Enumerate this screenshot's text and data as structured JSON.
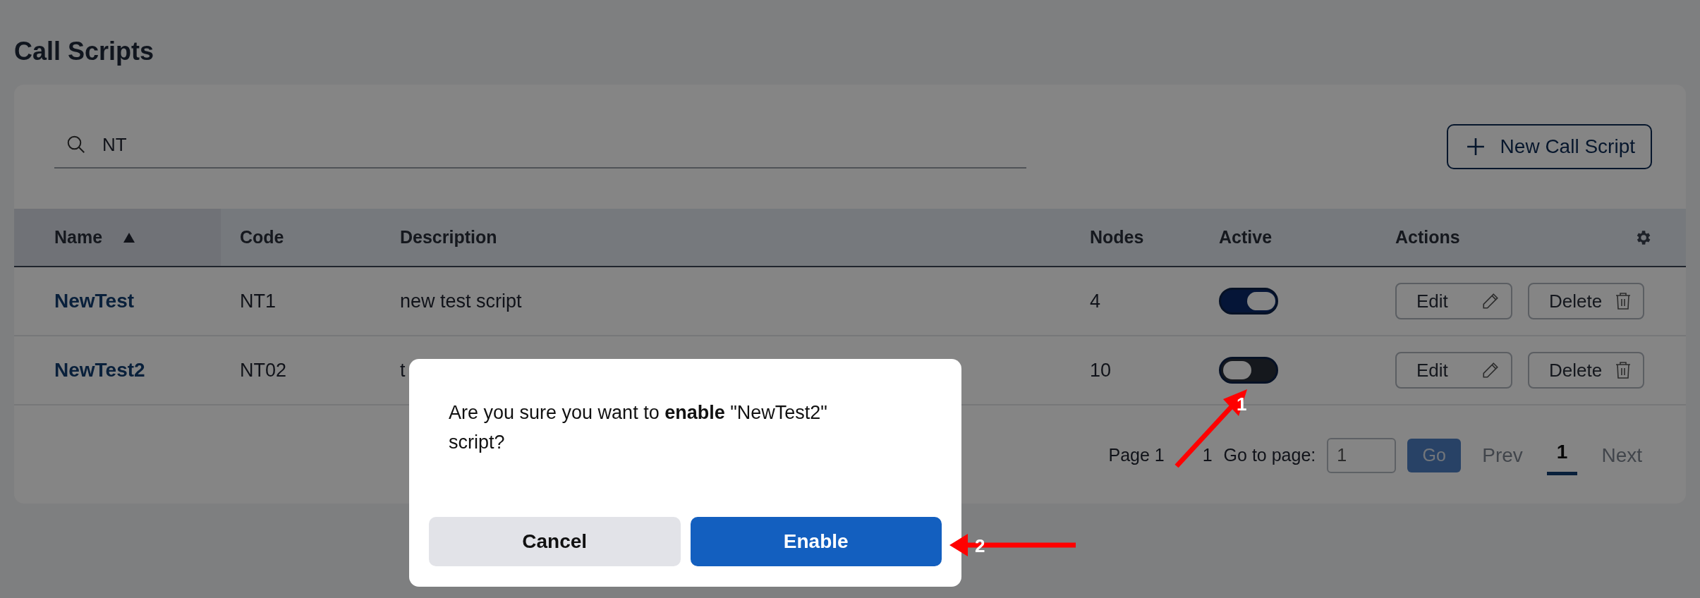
{
  "page": {
    "title": "Call Scripts"
  },
  "search": {
    "value": "NT"
  },
  "new_button": {
    "label": "New Call Script"
  },
  "table": {
    "columns": [
      {
        "label": "Name",
        "sorted": true
      },
      {
        "label": "Code",
        "sorted": false
      },
      {
        "label": "Description",
        "sorted": false
      },
      {
        "label": "Nodes",
        "sorted": false
      },
      {
        "label": "Active",
        "sorted": false
      },
      {
        "label": "Actions",
        "sorted": false
      }
    ],
    "rows": [
      {
        "name": "NewTest",
        "code": "NT1",
        "description": "new test script",
        "nodes": "4",
        "active": true,
        "edit": "Edit",
        "delete": "Delete"
      },
      {
        "name": "NewTest2",
        "code": "NT02",
        "description": "t",
        "nodes": "10",
        "active": false,
        "edit": "Edit",
        "delete": "Delete"
      }
    ]
  },
  "pagination": {
    "summary_start": "Page 1",
    "summary_end": "1",
    "goto_label": "Go to page:",
    "goto_value": "1",
    "go": "Go",
    "prev": "Prev",
    "pages": [
      {
        "label": "1",
        "selected": true
      }
    ],
    "next": "Next"
  },
  "dialog": {
    "message": "Are you sure you want to **enable** \"NewTest2\" script?",
    "cancel": "Cancel",
    "confirm": "Enable"
  },
  "annotations": [
    {
      "label": "1"
    },
    {
      "label": "2"
    }
  ]
}
